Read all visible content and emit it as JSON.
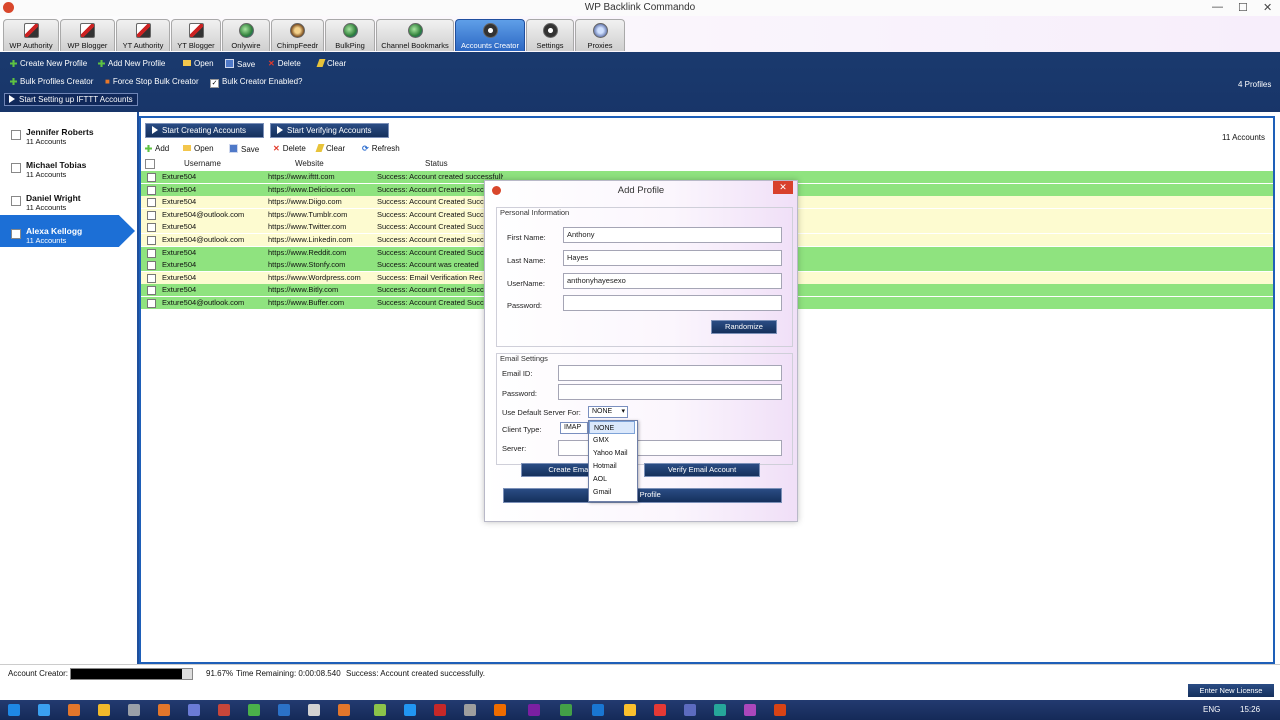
{
  "window": {
    "title": "WP Backlink Commando",
    "min": "—",
    "max": "☐",
    "close": "✕"
  },
  "tabs": [
    {
      "label": "WP Authority"
    },
    {
      "label": "WP Blogger"
    },
    {
      "label": "YT Authority"
    },
    {
      "label": "YT Blogger"
    },
    {
      "label": "Onlywire"
    },
    {
      "label": "ChimpFeedr"
    },
    {
      "label": "BulkPing"
    },
    {
      "label": "Channel Bookmarks"
    },
    {
      "label": "Accounts Creator"
    },
    {
      "label": "Settings"
    },
    {
      "label": "Proxies"
    }
  ],
  "toolbar": {
    "create_new_profile": "Create New Profile",
    "add_new_profile": "Add New Profile",
    "open": "Open",
    "save": "Save",
    "delete": "Delete",
    "clear": "Clear",
    "bulk_profiles_creator": "Bulk Profiles Creator",
    "force_stop": "Force Stop Bulk Creator",
    "bulk_enabled": "Bulk Creator Enabled?",
    "profiles_count": "4 Profiles",
    "ifttt": "Start Setting up IFTTT Accounts"
  },
  "profiles": [
    {
      "name": "Jennifer Roberts",
      "count": "11 Accounts"
    },
    {
      "name": "Michael Tobias",
      "count": "11 Accounts"
    },
    {
      "name": "Daniel Wright",
      "count": "11 Accounts"
    },
    {
      "name": "Alexa Kellogg",
      "count": "11 Accounts"
    }
  ],
  "main": {
    "start_creating": "Start Creating Accounts",
    "start_verifying": "Start Verifying Accounts",
    "accounts_count": "11 Accounts",
    "grid_toolbar": {
      "add": "Add",
      "open": "Open",
      "save": "Save",
      "delete": "Delete",
      "clear": "Clear",
      "refresh": "Refresh"
    },
    "columns": {
      "username": "Username",
      "website": "Website",
      "status": "Status"
    },
    "rows": [
      {
        "username": "Exture504",
        "website": "https://www.ifttt.com",
        "status": "Success: Account created successfully",
        "color": "green"
      },
      {
        "username": "Exture504",
        "website": "https://www.Delicious.com",
        "status": "Success: Account Created Succ",
        "color": "green"
      },
      {
        "username": "Exture504",
        "website": "https://www.Diigo.com",
        "status": "Success: Account Created Succ",
        "color": "yellow"
      },
      {
        "username": "Exture504@outlook.com",
        "website": "https://www.Tumblr.com",
        "status": "Success: Account Created Succ",
        "color": "yellow"
      },
      {
        "username": "Exture504",
        "website": "https://www.Twitter.com",
        "status": "Success: Account Created Succ",
        "color": "yellow"
      },
      {
        "username": "Exture504@outlook.com",
        "website": "https://www.Linkedin.com",
        "status": "Success: Account Created Succ",
        "color": "yellow"
      },
      {
        "username": "Exture504",
        "website": "https://www.Reddit.com",
        "status": "Success: Account Created Succ",
        "color": "green"
      },
      {
        "username": "Exture504",
        "website": "https://www.Stonfy.com",
        "status": "Success: Account was created",
        "color": "green"
      },
      {
        "username": "Exture504",
        "website": "https://www.Wordpress.com",
        "status": "Success: Email Verification Rec",
        "color": "yellow"
      },
      {
        "username": "Exture504",
        "website": "https://www.Bitly.com",
        "status": "Success: Account Created Succ",
        "color": "green"
      },
      {
        "username": "Exture504@outlook.com",
        "website": "https://www.Buffer.com",
        "status": "Success: Account Created Succ",
        "color": "green"
      }
    ]
  },
  "dialog": {
    "title": "Add Profile",
    "close": "✕",
    "personal_title": "Personal Information",
    "first_name_label": "First Name:",
    "first_name": "Anthony",
    "last_name_label": "Last Name:",
    "last_name": "Hayes",
    "username_label": "UserName:",
    "username": "anthonyhayesexo",
    "password_label": "Password:",
    "password": "",
    "randomize": "Randomize",
    "email_title": "Email Settings",
    "email_label": "Email ID:",
    "email_password_label": "Password:",
    "default_server_label": "Use Default Server For:",
    "default_server_value": "NONE",
    "client_type_label": "Client Type:",
    "client_type_value": "IMAP",
    "server_label": "Server:",
    "create_email": "Create Email",
    "verify_email": "Verify Email Account",
    "add_profile": "Add Profile",
    "options": [
      "NONE",
      "GMX",
      "Yahoo Mail",
      "Hotmail",
      "AOL",
      "Gmail"
    ]
  },
  "status": {
    "label": "Account Creator:",
    "percent": "91.67%",
    "time_remaining": "Time Remaining: 0:00:08.540",
    "message": "Success: Account created successfully.",
    "progress": 0.9167,
    "license": "Enter New License"
  },
  "taskbar": {
    "lang": "ENG",
    "time": "15:26"
  }
}
